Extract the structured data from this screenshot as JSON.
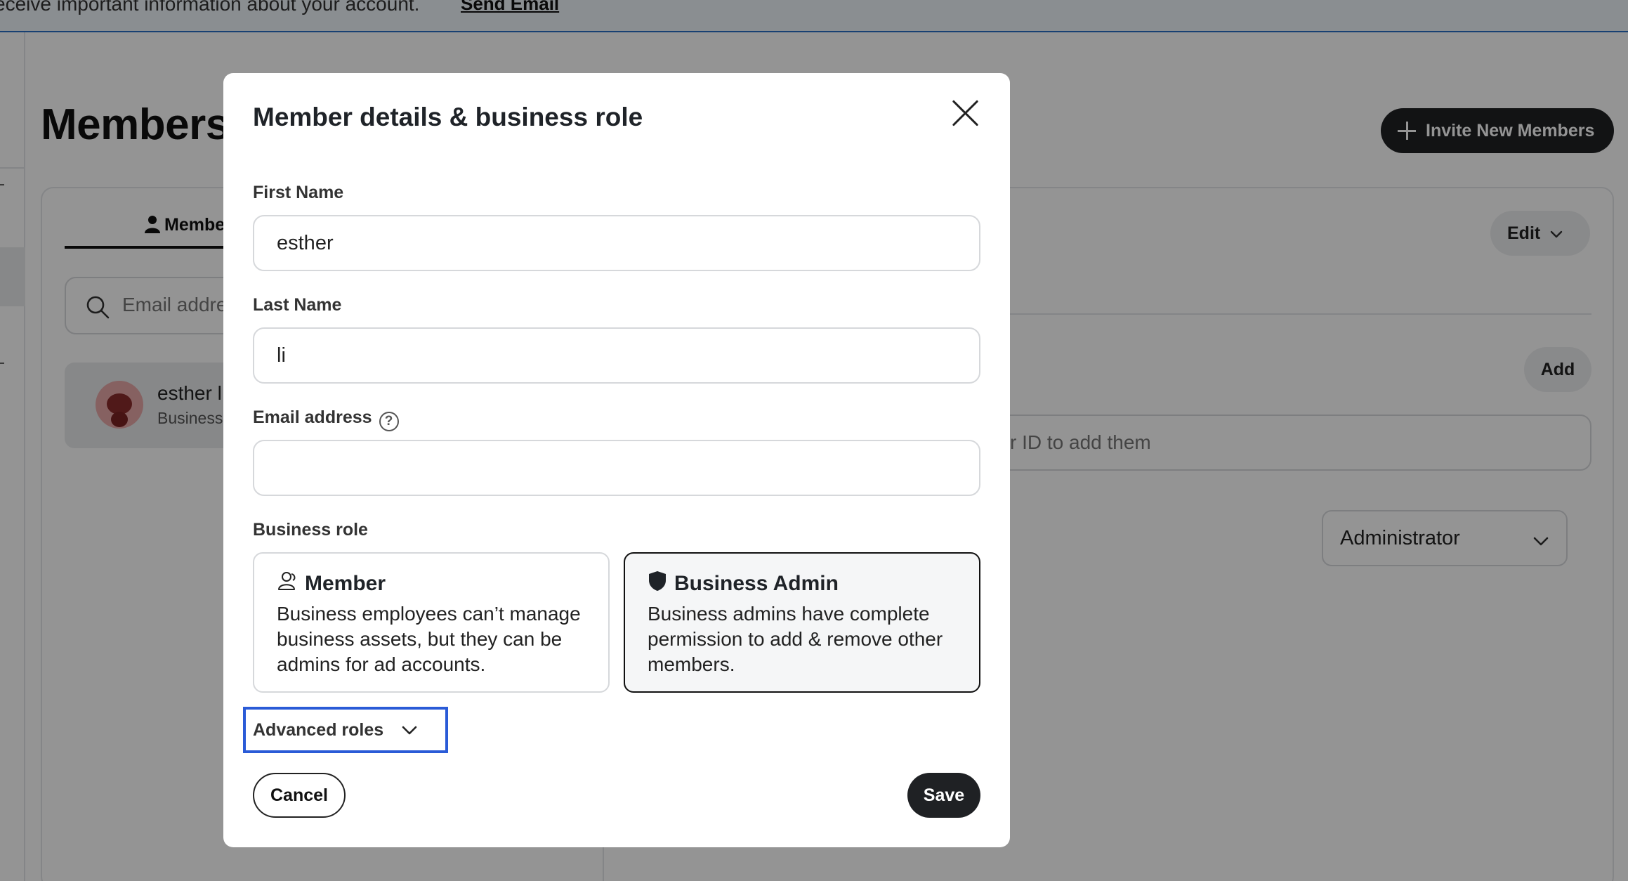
{
  "banner": {
    "text": "eceive important information about your account.",
    "link": "Send Email"
  },
  "page": {
    "title": "Members",
    "invite_button": "Invite New Members"
  },
  "left_panel": {
    "tab_label": "Membe",
    "search_placeholder": "Email addre",
    "member": {
      "name": "esther l",
      "role": "Business"
    }
  },
  "right_panel": {
    "edit_button": "Edit",
    "add_button": "Add",
    "id_placeholder": "r ID to add them",
    "role_select_value": "Administrator"
  },
  "modal": {
    "title": "Member details & business role",
    "first_name": {
      "label": "First Name",
      "value": "esther"
    },
    "last_name": {
      "label": "Last Name",
      "value": "li"
    },
    "email": {
      "label": "Email address",
      "value": "",
      "help": "?"
    },
    "business_role": {
      "label": "Business role",
      "options": [
        {
          "title": "Member",
          "description": "Business employees can’t manage business assets, but they can be admins for ad accounts.",
          "selected": false,
          "icon": "people-icon"
        },
        {
          "title": "Business Admin",
          "description": "Business admins have complete permission to add & remove other members.",
          "selected": true,
          "icon": "shield-icon"
        }
      ]
    },
    "advanced_roles": "Advanced roles",
    "cancel_button": "Cancel",
    "save_button": "Save"
  },
  "colors": {
    "overlay": "rgba(0,0,0,0.42)",
    "primary_button": "#1f2124",
    "focus_outline": "#2a5bd7",
    "banner_border": "#2a6fc4"
  }
}
